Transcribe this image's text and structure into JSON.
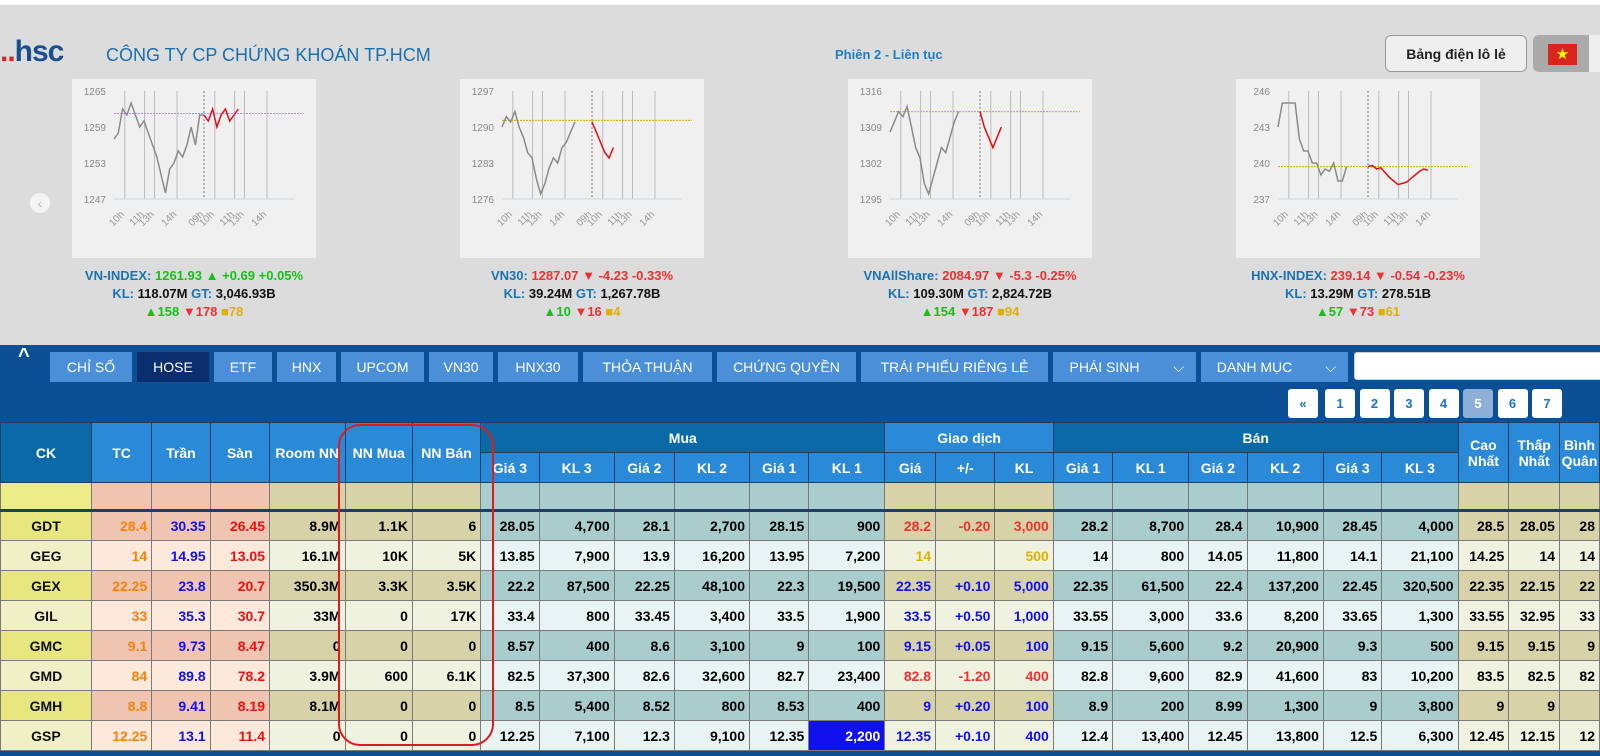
{
  "header": {
    "logo": "..hsc",
    "company": "CÔNG TY CP CHỨNG KHOÁN TP.HCM",
    "session": "Phiên 2 - Liên tục",
    "odd_lot_button": "Bảng điện lô lẻ",
    "language_icon": "vietnam-flag-icon"
  },
  "colors": {
    "up": "#17c017",
    "down": "#f03030",
    "ref": "#e0b000",
    "ceiling": "#1010ee",
    "floor": "#ee1010",
    "tc": "#f5820a",
    "accent": "#0c4f95",
    "annotation": "#e21a1a"
  },
  "indices": [
    {
      "name": "VN-INDEX:",
      "value": "1261.93",
      "dir": "up",
      "arrow": "▲",
      "change": "+0.69",
      "pct": "+0.05%",
      "kl_label": "KL:",
      "kl": "118.07M",
      "gt_label": "GT:",
      "gt": "3,046.93B",
      "adv": "▲158",
      "dec": "▼178",
      "unch": "■78",
      "chart": {
        "yticks": [
          "1265",
          "1259",
          "1253",
          "1247"
        ],
        "ymin": 1247,
        "ymax": 1265,
        "ref": 1261.24,
        "prev": [
          1257,
          1258,
          1262,
          1261,
          1263,
          1261,
          1259,
          1260,
          1258,
          1256,
          1254,
          1251,
          1248,
          1252,
          1253,
          1255,
          1254,
          1256,
          1259,
          1256,
          1261,
          1261
        ],
        "today": [
          1261,
          1260,
          1262,
          1259,
          1261,
          1262,
          1260,
          1261,
          1262
        ]
      }
    },
    {
      "name": "VN30:",
      "value": "1287.07",
      "dir": "dn",
      "arrow": "▼",
      "change": "-4.23",
      "pct": "-0.33%",
      "kl_label": "KL:",
      "kl": "39.24M",
      "gt_label": "GT:",
      "gt": "1,267.78B",
      "adv": "▲10",
      "dec": "▼16",
      "unch": "■4",
      "chart": {
        "yticks": [
          "1297",
          "1290",
          "1283",
          "1276"
        ],
        "ymin": 1276,
        "ymax": 1297,
        "ref": 1291.3,
        "prev": [
          1290,
          1292,
          1291,
          1293,
          1290,
          1288,
          1285,
          1284,
          1280,
          1277,
          1279,
          1282,
          1284,
          1283,
          1286,
          1287,
          1289,
          1291
        ],
        "today": [
          1291,
          1289,
          1287,
          1285,
          1284,
          1286
        ]
      }
    },
    {
      "name": "VNAllShare:",
      "value": "2084.97",
      "dir": "dn",
      "arrow": "▼",
      "change": "-5.3",
      "pct": "-0.25%",
      "kl_label": "KL:",
      "kl": "109.30M",
      "gt_label": "GT:",
      "gt": "2,824.72B",
      "adv": "▲154",
      "dec": "▼187",
      "unch": "■94",
      "chart": {
        "yticks": [
          "1316",
          "1309",
          "1302",
          "1295"
        ],
        "ymin": 1295,
        "ymax": 1316,
        "ref": 1312,
        "prev": [
          1308,
          1310,
          1312,
          1311,
          1313,
          1309,
          1305,
          1303,
          1298,
          1296,
          1299,
          1302,
          1305,
          1304,
          1307,
          1310,
          1312
        ],
        "today": [
          1312,
          1309,
          1307,
          1305,
          1307,
          1309
        ]
      }
    },
    {
      "name": "HNX-INDEX:",
      "value": "239.14",
      "dir": "dn",
      "arrow": "▼",
      "change": "-0.54",
      "pct": "-0.23%",
      "kl_label": "KL:",
      "kl": "13.29M",
      "gt_label": "GT:",
      "gt": "278.51B",
      "adv": "▲57",
      "dec": "▼73",
      "unch": "■61",
      "chart": {
        "yticks": [
          "246",
          "243",
          "240",
          "237"
        ],
        "ymin": 237,
        "ymax": 246,
        "ref": 239.7,
        "prev": [
          243,
          245,
          245,
          245,
          245,
          242,
          241,
          241,
          240,
          240,
          239,
          239.5,
          239.3,
          240,
          238.5,
          238.5,
          239.7
        ],
        "today": [
          239.7,
          239.8,
          239.5,
          239.6,
          239.2,
          238.8,
          238.5,
          238.2,
          238.3,
          238.4,
          238.7,
          239,
          239.3,
          239.5,
          239.4
        ]
      }
    }
  ],
  "chart_xticks": [
    "10h",
    "11h",
    "13h",
    "14h",
    "09h",
    "10h",
    "11h",
    "13h",
    "14h"
  ],
  "nav": {
    "collapse_icon": "caret-up-icon",
    "tabs": [
      {
        "label": "CHỈ SỐ"
      },
      {
        "label": "HOSE",
        "active": true
      },
      {
        "label": "ETF"
      },
      {
        "label": "HNX"
      },
      {
        "label": "UPCOM"
      },
      {
        "label": "VN30"
      },
      {
        "label": "HNX30"
      },
      {
        "label": "THỎA THUẬN"
      },
      {
        "label": "CHỨNG QUYỀN"
      },
      {
        "label": "TRÁI PHIẾU RIÊNG LẺ"
      },
      {
        "label": "PHÁI SINH",
        "dropdown": true
      },
      {
        "label": "DANH MỤC",
        "dropdown": true
      }
    ],
    "search_value": ""
  },
  "pagination": {
    "prev": "«",
    "pages": [
      "1",
      "2",
      "3",
      "4",
      "5",
      "6",
      "7"
    ],
    "current": "5"
  },
  "table": {
    "headers": {
      "ck": "CK",
      "tc": "TC",
      "tran": "Trần",
      "san": "Sàn",
      "room": "Room NN",
      "nn_mua": "NN Mua",
      "nn_ban": "NN Bán",
      "mua": "Mua",
      "giao_dich": "Giao dịch",
      "ban": "Bán",
      "cao": "Cao Nhất",
      "thap": "Thấp Nhất",
      "bq": "Bình Quân",
      "mua_sub": [
        "Giá 3",
        "KL 3",
        "Giá 2",
        "KL 2",
        "Giá 1",
        "KL 1"
      ],
      "gd_sub": [
        "Giá",
        "+/-",
        "KL"
      ],
      "ban_sub": [
        "Giá 1",
        "KL 1",
        "Giá 2",
        "KL 2",
        "Giá 3",
        "KL 3"
      ]
    },
    "rows": [
      {
        "ck": "GDT",
        "trend": "down",
        "v": [
          "28.4",
          "30.35",
          "26.45",
          "8.9M",
          "1.1K",
          "6",
          "28.05",
          "4,700",
          "28.1",
          "2,700",
          "28.15",
          "900",
          "28.2",
          "-0.20",
          "3,000",
          "28.2",
          "8,700",
          "28.4",
          "10,900",
          "28.45",
          "4,000",
          "28.5",
          "28.05",
          "28"
        ]
      },
      {
        "ck": "GEG",
        "trend": "ref",
        "v": [
          "14",
          "14.95",
          "13.05",
          "16.1M",
          "10K",
          "5K",
          "13.85",
          "7,900",
          "13.9",
          "16,200",
          "13.95",
          "7,200",
          "14",
          "",
          "500",
          "14",
          "800",
          "14.05",
          "11,800",
          "14.1",
          "21,100",
          "14.25",
          "14",
          "14"
        ]
      },
      {
        "ck": "GEX",
        "trend": "up",
        "v": [
          "22.25",
          "23.8",
          "20.7",
          "350.3M",
          "3.3K",
          "3.5K",
          "22.2",
          "87,500",
          "22.25",
          "48,100",
          "22.3",
          "19,500",
          "22.35",
          "+0.10",
          "5,000",
          "22.35",
          "61,500",
          "22.4",
          "137,200",
          "22.45",
          "320,500",
          "22.35",
          "22.15",
          "22"
        ]
      },
      {
        "ck": "GIL",
        "trend": "up",
        "v": [
          "33",
          "35.3",
          "30.7",
          "33M",
          "0",
          "17K",
          "33.4",
          "800",
          "33.45",
          "3,400",
          "33.5",
          "1,900",
          "33.5",
          "+0.50",
          "1,000",
          "33.55",
          "3,000",
          "33.6",
          "8,200",
          "33.65",
          "1,300",
          "33.55",
          "32.95",
          "33"
        ]
      },
      {
        "ck": "GMC",
        "trend": "up",
        "v": [
          "9.1",
          "9.73",
          "8.47",
          "0",
          "0",
          "0",
          "8.57",
          "400",
          "8.6",
          "3,100",
          "9",
          "100",
          "9.15",
          "+0.05",
          "100",
          "9.15",
          "5,600",
          "9.2",
          "20,900",
          "9.3",
          "500",
          "9.15",
          "9.15",
          "9"
        ]
      },
      {
        "ck": "GMD",
        "trend": "down",
        "v": [
          "84",
          "89.8",
          "78.2",
          "3.9M",
          "600",
          "6.1K",
          "82.5",
          "37,300",
          "82.6",
          "32,600",
          "82.7",
          "23,400",
          "82.8",
          "-1.20",
          "400",
          "82.8",
          "9,600",
          "82.9",
          "41,600",
          "83",
          "10,200",
          "83.5",
          "82.5",
          "82"
        ]
      },
      {
        "ck": "GMH",
        "trend": "up",
        "v": [
          "8.8",
          "9.41",
          "8.19",
          "8.1M",
          "0",
          "0",
          "8.5",
          "5,400",
          "8.52",
          "800",
          "8.53",
          "400",
          "9",
          "+0.20",
          "100",
          "8.9",
          "200",
          "8.99",
          "1,300",
          "9",
          "3,800",
          "9",
          "9",
          ""
        ]
      },
      {
        "ck": "GSP",
        "trend": "up",
        "highlight_col": 11,
        "v": [
          "12.25",
          "13.1",
          "11.4",
          "0",
          "0",
          "0",
          "12.25",
          "7,100",
          "12.3",
          "9,100",
          "12.35",
          "2,200",
          "12.35",
          "+0.10",
          "400",
          "12.4",
          "13,400",
          "12.45",
          "13,800",
          "12.5",
          "6,300",
          "12.45",
          "12.15",
          "12"
        ]
      }
    ]
  }
}
